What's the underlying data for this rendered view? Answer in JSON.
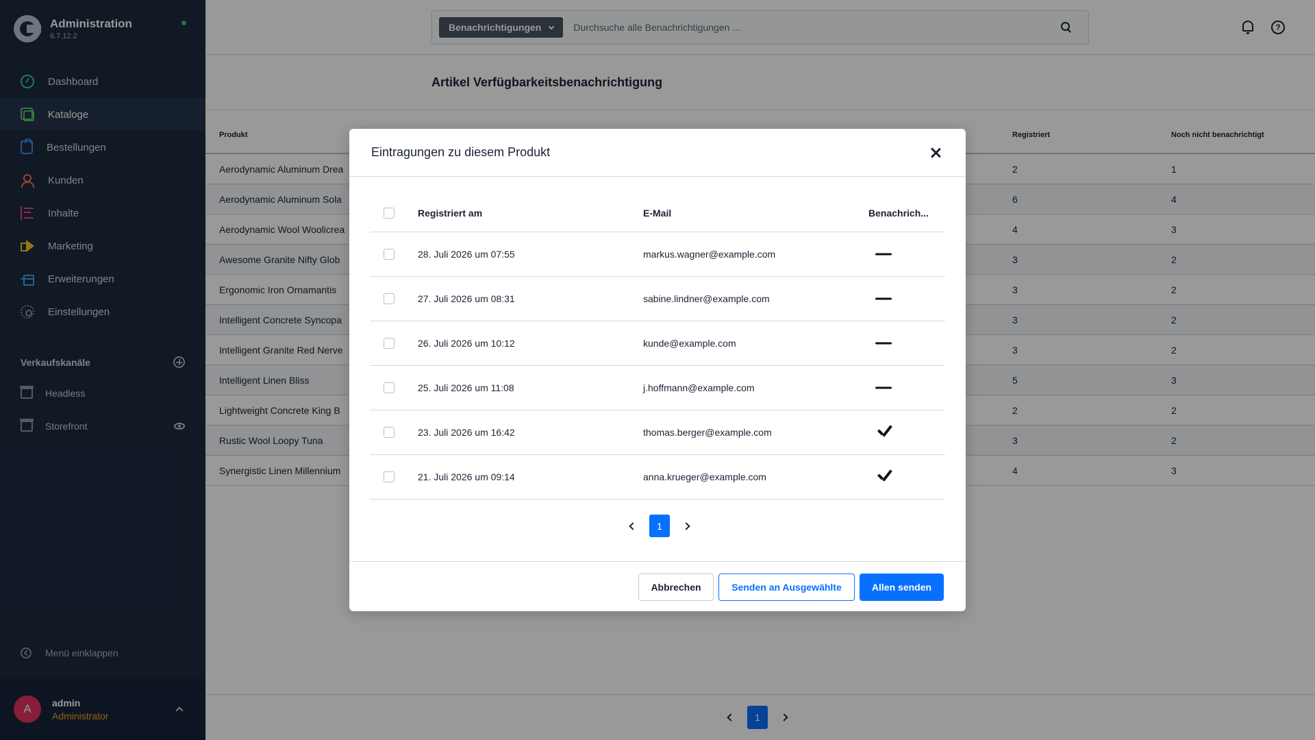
{
  "app": {
    "title": "Administration",
    "version": "6.7.12.2"
  },
  "sidebar": {
    "items": [
      {
        "label": "Dashboard",
        "icon": "dashboard-icon"
      },
      {
        "label": "Kataloge",
        "icon": "catalog-icon",
        "active": true
      },
      {
        "label": "Bestellungen",
        "icon": "orders-icon"
      },
      {
        "label": "Kunden",
        "icon": "customers-icon"
      },
      {
        "label": "Inhalte",
        "icon": "content-icon"
      },
      {
        "label": "Marketing",
        "icon": "marketing-icon"
      },
      {
        "label": "Erweiterungen",
        "icon": "extensions-icon"
      },
      {
        "label": "Einstellungen",
        "icon": "settings-icon"
      }
    ],
    "channels_title": "Verkaufskanäle",
    "channels": [
      {
        "label": "Headless",
        "icon": "store-icon"
      },
      {
        "label": "Storefront",
        "icon": "store-icon"
      }
    ],
    "collapse_label": "Menü einklappen",
    "user": {
      "initial": "A",
      "name": "admin",
      "role": "Administrator"
    }
  },
  "header": {
    "search_type": "Benachrichtigungen",
    "search_placeholder": "Durchsuche alle Benachrichtigungen ..."
  },
  "page": {
    "title": "Artikel Verfügbarkeitsbenachrichtigung",
    "columns": {
      "product": "Produkt",
      "registered": "Registriert",
      "not_notified": "Noch nicht benachrichtigt"
    },
    "rows": [
      {
        "product": "Aerodynamic Aluminum Drea",
        "registered": "2",
        "not_notified": "1"
      },
      {
        "product": "Aerodynamic Aluminum Sola",
        "registered": "6",
        "not_notified": "4"
      },
      {
        "product": "Aerodynamic Wool Woolicrea",
        "registered": "4",
        "not_notified": "3"
      },
      {
        "product": "Awesome Granite Nifty Glob",
        "registered": "3",
        "not_notified": "2"
      },
      {
        "product": "Ergonomic Iron Ornamantis",
        "registered": "3",
        "not_notified": "2"
      },
      {
        "product": "Intelligent Concrete Syncopa",
        "registered": "3",
        "not_notified": "2"
      },
      {
        "product": "Intelligent Granite Red Nerve",
        "registered": "3",
        "not_notified": "2"
      },
      {
        "product": "Intelligent Linen Bliss",
        "registered": "5",
        "not_notified": "3"
      },
      {
        "product": "Lightweight Concrete King B",
        "registered": "2",
        "not_notified": "2"
      },
      {
        "product": "Rustic Wool Loopy Tuna",
        "registered": "3",
        "not_notified": "2"
      },
      {
        "product": "Synergistic Linen Millennium",
        "registered": "4",
        "not_notified": "3"
      }
    ],
    "pagination": {
      "current": "1"
    }
  },
  "modal": {
    "title": "Eintragungen zu diesem Produkt",
    "columns": {
      "date": "Registriert am",
      "email": "E-Mail",
      "notified": "Benachrich..."
    },
    "rows": [
      {
        "date": "28. Juli 2026 um 07:55",
        "email": "markus.wagner@example.com",
        "notified": false
      },
      {
        "date": "27. Juli 2026 um 08:31",
        "email": "sabine.lindner@example.com",
        "notified": false
      },
      {
        "date": "26. Juli 2026 um 10:12",
        "email": "kunde@example.com",
        "notified": false
      },
      {
        "date": "25. Juli 2026 um 11:08",
        "email": "j.hoffmann@example.com",
        "notified": false
      },
      {
        "date": "23. Juli 2026 um 16:42",
        "email": "thomas.berger@example.com",
        "notified": true
      },
      {
        "date": "21. Juli 2026 um 09:14",
        "email": "anna.krueger@example.com",
        "notified": true
      }
    ],
    "pagination": {
      "current": "1"
    },
    "buttons": {
      "cancel": "Abbrechen",
      "send_selected": "Senden an Ausgewählte",
      "send_all": "Allen senden"
    }
  },
  "colors": {
    "sidebar_bg": "#1b2a3d",
    "primary": "#0870ff",
    "status_online": "#3dbf6e",
    "avatar": "#e0325e",
    "role": "#f5a623"
  }
}
